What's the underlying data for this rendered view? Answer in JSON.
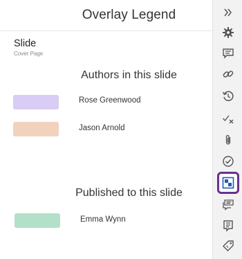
{
  "panel": {
    "title": "Overlay Legend",
    "slide_label": "Slide",
    "slide_subtitle": "Cover Page"
  },
  "authors": {
    "title": "Authors in this slide",
    "items": [
      {
        "name": "Rose Greenwood",
        "color": "#d9ccf5"
      },
      {
        "name": "Jason Arnold",
        "color": "#f1d2bc"
      }
    ]
  },
  "published": {
    "title": "Published to this slide",
    "items": [
      {
        "name": "Emma Wynn",
        "color": "#b3e0c9"
      }
    ]
  },
  "sidebar": {
    "active_icon": "overlay-legend-icon",
    "accent_color": "#6b2f8f",
    "icons": [
      "collapse-double-chevron-icon",
      "gear-icon",
      "comment-icon",
      "link-icon",
      "history-icon",
      "check-x-icon",
      "paperclip-icon",
      "check-circle-icon",
      "overlay-legend-icon",
      "comments-list-icon",
      "note-icon",
      "tag-icon"
    ]
  }
}
